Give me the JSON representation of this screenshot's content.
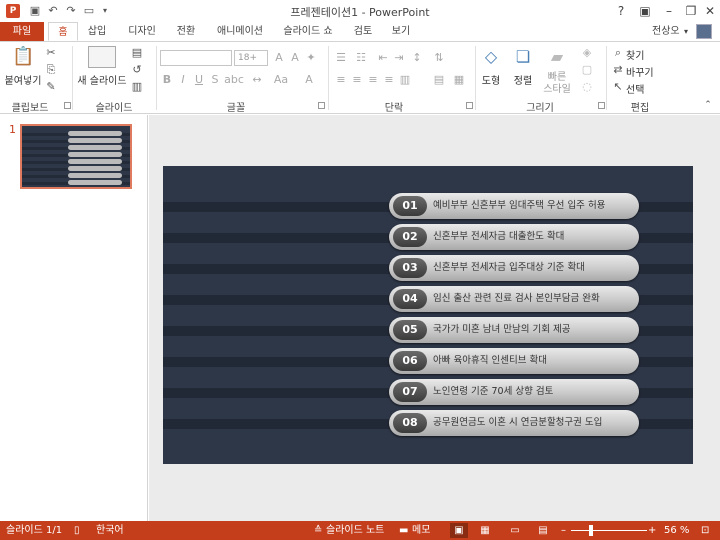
{
  "titlebar": {
    "title": "프레젠테이션1 - PowerPoint",
    "app_icon": "P",
    "qat_icons": [
      "save-icon",
      "undo-icon",
      "redo-icon",
      "present-from-start-icon",
      "customize-icon"
    ],
    "help": "?"
  },
  "tabs": {
    "file": "파일",
    "items": [
      "홈",
      "삽입",
      "디자인",
      "전환",
      "애니메이션",
      "슬라이드 쇼",
      "검토",
      "보기"
    ],
    "active": "홈",
    "user": "전상오"
  },
  "ribbon": {
    "groups": [
      "클립보드",
      "슬라이드",
      "글꼴",
      "단락",
      "그리기",
      "편집"
    ],
    "paste_label": "붙여넣기",
    "new_slide_label": "새 슬라이드",
    "font_size": "18+",
    "shapes_label": "도형",
    "arrange_label": "정렬",
    "quick_styles_label": "빠른\n스타일",
    "find_label": "찾기",
    "replace_label": "바꾸기",
    "select_label": "선택"
  },
  "thumbnail": {
    "number": "1"
  },
  "slide": {
    "items": [
      {
        "num": "01",
        "text": "예비부부 신혼부부 임대주택 우선 입주 허용"
      },
      {
        "num": "02",
        "text": "신혼부부 전세자금 대출한도 확대"
      },
      {
        "num": "03",
        "text": "신혼부부 전세자금 입주대상 기준 확대"
      },
      {
        "num": "04",
        "text": "임신 출산 관련 진료 검사 본인부담금 완화"
      },
      {
        "num": "05",
        "text": "국가가 미혼 남녀 만남의 기회 제공"
      },
      {
        "num": "06",
        "text": "아빠 육아휴직 인센티브 확대"
      },
      {
        "num": "07",
        "text": "노인연령 기준 70세 상향 검토"
      },
      {
        "num": "08",
        "text": "공무원연금도 이혼 시 연금분할청구권 도입"
      }
    ]
  },
  "statusbar": {
    "slide_count": "슬라이드 1/1",
    "language": "한국어",
    "notes": "슬라이드 노트",
    "comments": "메모",
    "zoom": "56 %",
    "zoom_level_percent": 56
  },
  "colors": {
    "accent": "#c43e1c",
    "slide_bg": "#2e3748",
    "stripe": "#222936"
  }
}
